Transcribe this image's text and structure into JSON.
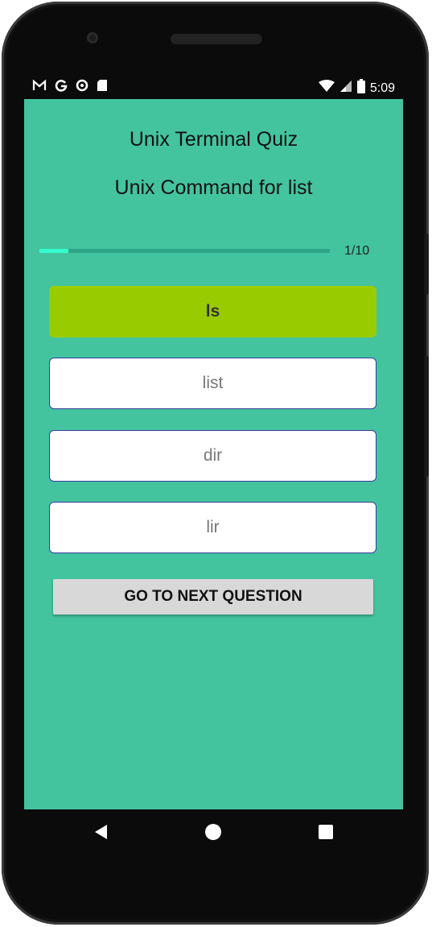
{
  "status_bar": {
    "left_icons": [
      "gmail-icon",
      "google-icon",
      "circle-icon",
      "sd-card-icon"
    ],
    "right_icons": [
      "wifi-icon",
      "signal-icon",
      "battery-icon"
    ],
    "time": "5:09"
  },
  "app": {
    "title": "Unix Terminal Quiz",
    "question": "Unix Command for list",
    "progress": {
      "label": "1/10",
      "fraction": 0.1
    },
    "options": [
      {
        "label": "ls",
        "state": "correct"
      },
      {
        "label": "list",
        "state": "normal"
      },
      {
        "label": "dir",
        "state": "normal"
      },
      {
        "label": "lir",
        "state": "normal"
      }
    ],
    "next_button": "GO TO NEXT QUESTION"
  },
  "nav_bar": {
    "buttons": [
      "back-icon",
      "home-icon",
      "recents-icon"
    ]
  },
  "colors": {
    "background": "#43c49f",
    "correct_option": "#99cc00",
    "progress_fill": "#33ffcc",
    "option_border": "#3b3b9a"
  }
}
